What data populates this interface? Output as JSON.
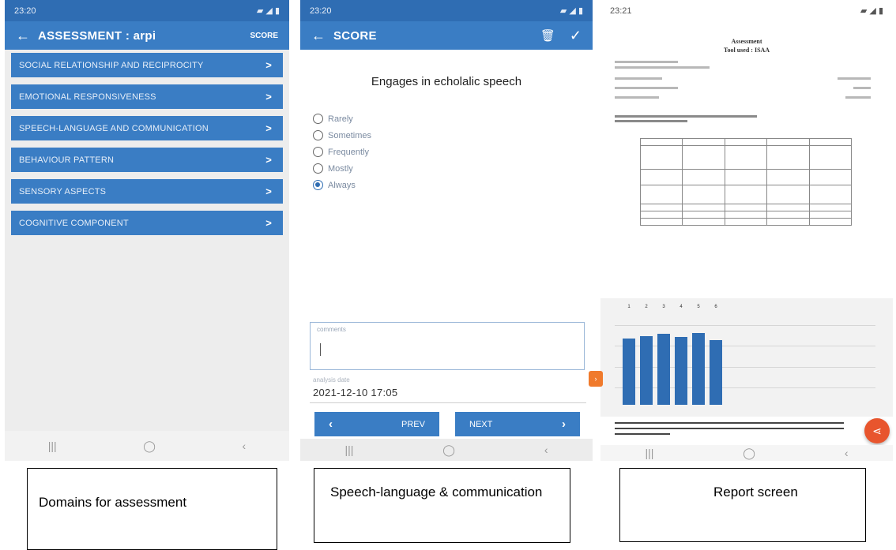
{
  "screen_domains": {
    "status_time": "23:20",
    "title": "ASSESSMENT : arpi",
    "action": "SCORE",
    "domains": [
      "SOCIAL RELATIONSHIP AND RECIPROCITY",
      "EMOTIONAL RESPONSIVENESS",
      "SPEECH-LANGUAGE AND COMMUNICATION",
      "BEHAVIOUR PATTERN",
      "SENSORY ASPECTS",
      "COGNITIVE COMPONENT"
    ],
    "chevron": ">"
  },
  "screen_score": {
    "status_time": "23:20",
    "title": "SCORE",
    "question": "Engages in echolalic speech",
    "options": [
      "Rarely",
      "Sometimes",
      "Frequently",
      "Mostly",
      "Always"
    ],
    "selected_option": "Always",
    "comments_label": "comments",
    "date_label": "analysis date",
    "date_value": "2021-12-10 17:05",
    "prev_label": "PREV",
    "next_label": "NEXT"
  },
  "screen_report": {
    "status_time": "23:21",
    "title": "Assessment",
    "subtitle": "Tool used : ISAA",
    "chart_data": {
      "type": "bar",
      "categories": [
        "1",
        "2",
        "3",
        "4",
        "5",
        "6"
      ],
      "values": [
        80,
        83,
        86,
        82,
        87,
        78
      ],
      "ylim": [
        0,
        100
      ]
    }
  },
  "captions": {
    "domains": "Domains for  assessment",
    "speech": "Speech-language & communication",
    "report": "Report screen"
  },
  "colors": {
    "primary": "#3a7dc4",
    "status_bar": "#2f6db3",
    "fab": "#e8552d"
  }
}
